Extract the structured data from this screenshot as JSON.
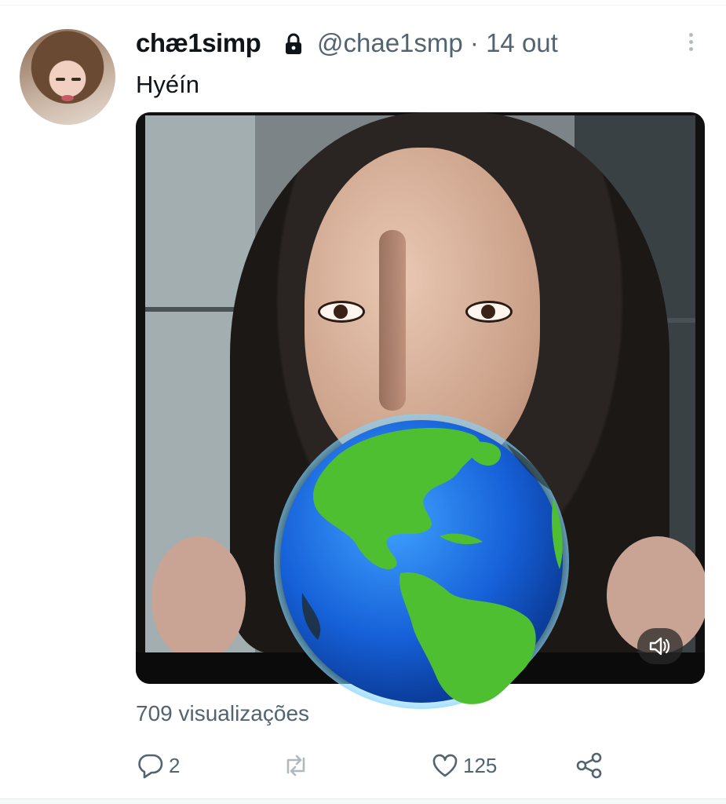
{
  "tweet": {
    "display_name": "chæ1simp",
    "handle_and_date": "@chae1smp · 14 out",
    "text": "Hyéín",
    "views": "709 visualizações",
    "actions": {
      "replies": "2",
      "retweets": "",
      "likes": "125"
    }
  },
  "icons": {
    "protected": "lock-icon",
    "more": "more-vertical-icon",
    "reply": "reply-icon",
    "retweet": "retweet-icon",
    "like": "heart-icon",
    "share": "share-icon",
    "mute": "speaker-muted-icon",
    "sticker": "globe-americas-icon"
  },
  "colors": {
    "text_primary": "#0f1419",
    "text_secondary": "#536471"
  }
}
